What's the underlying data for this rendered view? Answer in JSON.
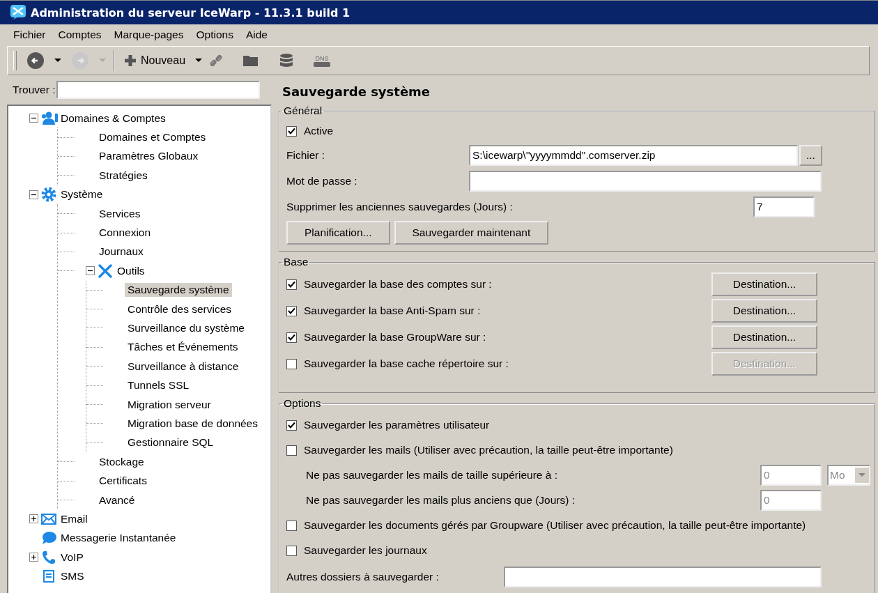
{
  "window": {
    "title": "Administration du serveur IceWarp - 11.3.1 build 1"
  },
  "menu": [
    "Fichier",
    "Comptes",
    "Marque-pages",
    "Options",
    "Aide"
  ],
  "toolbar": {
    "back_disabled": false,
    "forward_disabled": true,
    "new_label": "Nouveau",
    "dns_label": "DNS"
  },
  "search": {
    "label": "Trouver :"
  },
  "tree": [
    {
      "label": "Domaines & Comptes",
      "kind": "users",
      "expanded": true,
      "selected": false,
      "children": [
        {
          "label": "Domaines et Comptes",
          "selected": false
        },
        {
          "label": "Paramètres Globaux",
          "selected": false
        },
        {
          "label": "Stratégies",
          "selected": false
        }
      ]
    },
    {
      "label": "Système",
      "kind": "gear",
      "expanded": true,
      "selected": false,
      "children": [
        {
          "label": "Services",
          "selected": false
        },
        {
          "label": "Connexion",
          "selected": false
        },
        {
          "label": "Journaux",
          "selected": false
        },
        {
          "label": "Outils",
          "kind": "tools",
          "expanded": true,
          "selected": false,
          "children": [
            {
              "label": "Sauvegarde système",
              "selected": true
            },
            {
              "label": "Contrôle des services",
              "selected": false
            },
            {
              "label": "Surveillance du système",
              "selected": false
            },
            {
              "label": "Tâches et Événements",
              "selected": false
            },
            {
              "label": "Surveillance à distance",
              "selected": false
            },
            {
              "label": "Tunnels SSL",
              "selected": false
            },
            {
              "label": "Migration serveur",
              "selected": false
            },
            {
              "label": "Migration base de données",
              "selected": false
            },
            {
              "label": "Gestionnaire SQL",
              "selected": false
            }
          ]
        },
        {
          "label": "Stockage",
          "selected": false
        },
        {
          "label": "Certificats",
          "selected": false
        },
        {
          "label": "Avancé",
          "selected": false
        }
      ]
    },
    {
      "label": "Email",
      "kind": "mail",
      "expanded": false,
      "selected": false
    },
    {
      "label": "Messagerie Instantanée",
      "kind": "chat",
      "selected": false
    },
    {
      "label": "VoIP",
      "kind": "phone",
      "expanded": false,
      "selected": false
    },
    {
      "label": "SMS",
      "kind": "sms",
      "selected": false
    }
  ],
  "page_title": "Sauvegarde système",
  "general": {
    "legend": "Général",
    "active": {
      "label": "Active",
      "checked": true
    },
    "file": {
      "label": "Fichier :",
      "value": "S:\\icewarp\\''yyyymmdd''.comserver.zip",
      "browse": "..."
    },
    "password": {
      "label": "Mot de passe :"
    },
    "delete_old": {
      "label": "Supprimer les anciennes sauvegardes (Jours) :",
      "value": "7"
    },
    "buttons": [
      "Planification...",
      "Sauvegarder maintenant"
    ]
  },
  "base": {
    "legend": "Base",
    "rows": [
      {
        "label": "Sauvegarder la base des comptes sur :",
        "checked": true,
        "button": "Destination...",
        "disabled": false
      },
      {
        "label": "Sauvegarder la base Anti-Spam sur :",
        "checked": true,
        "button": "Destination...",
        "disabled": false
      },
      {
        "label": "Sauvegarder la base GroupWare sur :",
        "checked": true,
        "button": "Destination...",
        "disabled": false
      },
      {
        "label": "Sauvegarder la base cache répertoire sur :",
        "checked": false,
        "button": "Destination...",
        "disabled": true
      }
    ]
  },
  "options": {
    "legend": "Options",
    "rows": [
      {
        "kind": "checkbox",
        "label": "Sauvegarder les paramètres utilisateur",
        "checked": true
      },
      {
        "kind": "checkbox",
        "label": "Sauvegarder les mails (Utiliser avec précaution, la taille peut-être importante)",
        "checked": false
      },
      {
        "kind": "size",
        "label": "Ne pas sauvegarder les mails de taille supérieure à :",
        "value": "0",
        "unit": "Mo",
        "disabled": true
      },
      {
        "kind": "number",
        "label": "Ne pas sauvegarder les mails plus anciens que (Jours) :",
        "value": "0",
        "disabled": true
      },
      {
        "kind": "checkbox",
        "label": "Sauvegarder les documents gérés par Groupware (Utiliser avec précaution, la taille peut-être importante)",
        "checked": false
      },
      {
        "kind": "checkbox",
        "label": "Sauvegarder les journaux",
        "checked": false
      },
      {
        "kind": "text",
        "label": "Autres dossiers à sauvegarder :"
      }
    ]
  }
}
